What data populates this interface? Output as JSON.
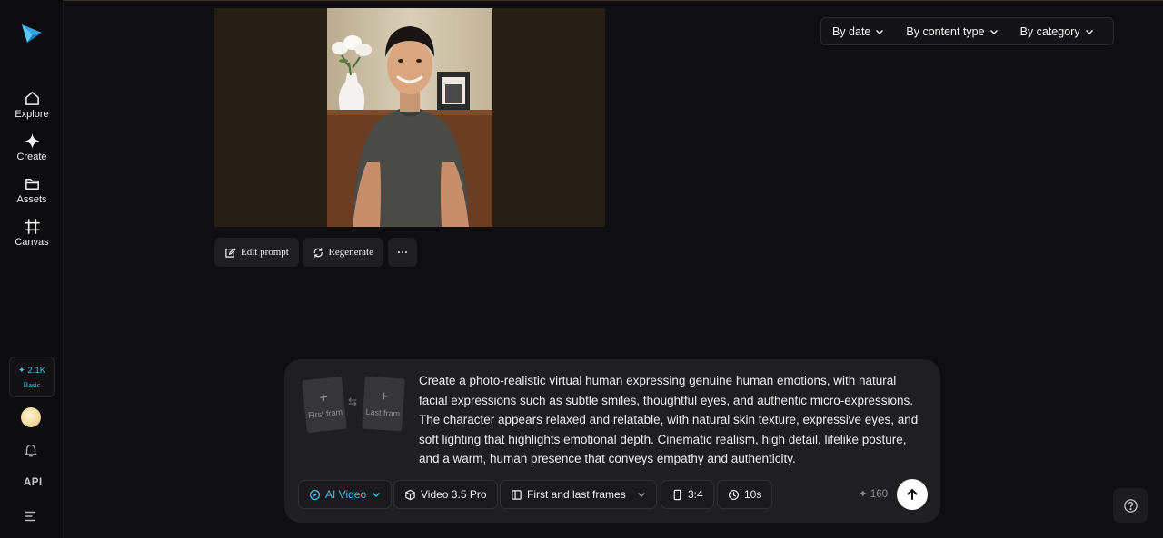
{
  "sidebar": {
    "items": [
      {
        "label": "Explore",
        "icon": "home-icon"
      },
      {
        "label": "Create",
        "icon": "sparkle-icon"
      },
      {
        "label": "Assets",
        "icon": "folder-icon"
      },
      {
        "label": "Canvas",
        "icon": "frame-icon"
      }
    ],
    "credits": {
      "value": "✦ 2.1K",
      "tier": "Basic"
    },
    "api_label": "API"
  },
  "filters": [
    {
      "label": "By date"
    },
    {
      "label": "By content type"
    },
    {
      "label": "By category"
    }
  ],
  "actions": {
    "edit_prompt": "Edit prompt",
    "regenerate": "Regenerate",
    "more": "···"
  },
  "prompt": {
    "first_frame_label": "First fram",
    "last_frame_label": "Last fram",
    "text": "Create a photo-realistic virtual human expressing genuine human emotions, with natural facial expressions such as subtle smiles, thoughtful eyes, and authentic micro-expressions. The character appears relaxed and relatable, with natural skin texture, expressive eyes, and soft lighting that highlights emotional depth. Cinematic realism, high detail, lifelike posture, and a warm, human presence that conveys empathy and authenticity.",
    "mode": "AI Video",
    "model": "Video 3.5 Pro",
    "frames_mode": "First and last frames",
    "aspect": "3:4",
    "duration": "10s",
    "cost": "✦ 160"
  },
  "colors": {
    "accent": "#36c0e6",
    "background": "#0f0f11",
    "panel": "#1f1f22"
  }
}
